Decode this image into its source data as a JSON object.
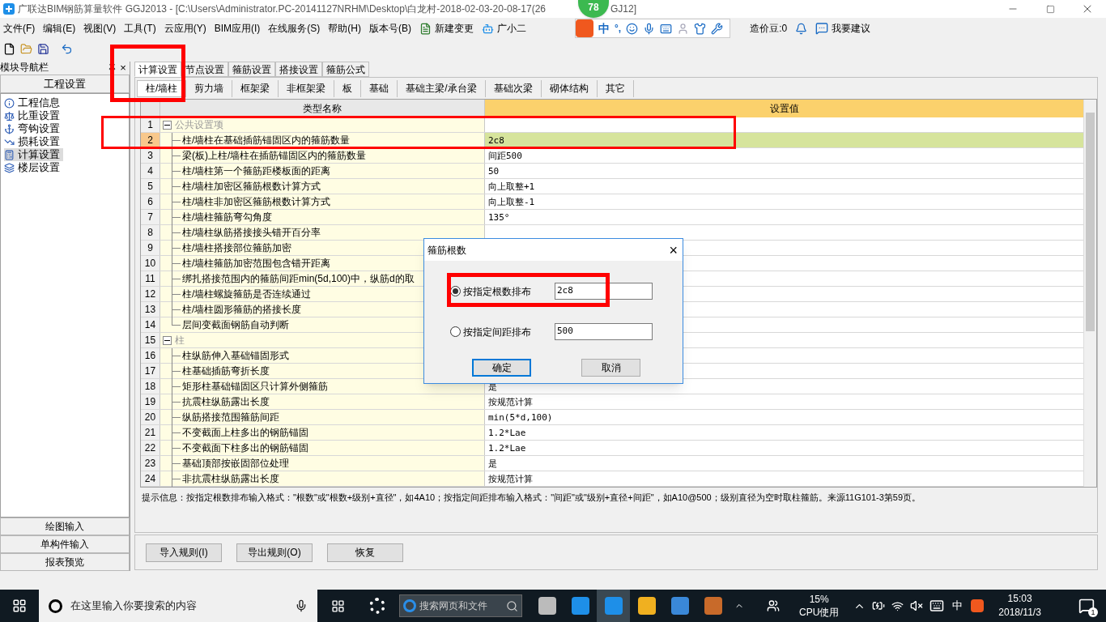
{
  "window": {
    "title": "广联达BIM钢筋算量软件 GGJ2013 - [C:\\Users\\Administrator.PC-20141127NRHM\\Desktop\\白龙村-2018-02-03-20-08-17(26",
    "title_tail": "GJ12]",
    "badge": "78"
  },
  "menu": [
    "文件(F)",
    "编辑(E)",
    "视图(V)",
    "工具(T)",
    "云应用(Y)",
    "BIM应用(I)",
    "在线服务(S)",
    "帮助(H)",
    "版本号(B)",
    "新建变更",
    "广小二"
  ],
  "ime": {
    "mode": "中",
    "punct": "°,"
  },
  "account": {
    "beans": "造价豆:0",
    "feedback": "我要建议"
  },
  "nav": {
    "title": "模块导航栏",
    "close": "×",
    "section": "工程设置",
    "items": [
      {
        "label": "工程信息",
        "selected": false
      },
      {
        "label": "比重设置",
        "selected": false
      },
      {
        "label": "弯钩设置",
        "selected": false
      },
      {
        "label": "损耗设置",
        "selected": false
      },
      {
        "label": "计算设置",
        "selected": true
      },
      {
        "label": "楼层设置",
        "selected": false
      }
    ],
    "bottom": [
      "绘图输入",
      "单构件输入",
      "报表预览"
    ]
  },
  "tabs": [
    {
      "label": "计算设置",
      "selected": true
    },
    {
      "label": "节点设置",
      "selected": false
    },
    {
      "label": "箍筋设置",
      "selected": false
    },
    {
      "label": "搭接设置",
      "selected": false
    },
    {
      "label": "箍筋公式",
      "selected": false
    }
  ],
  "subtabs": [
    {
      "label": "柱/墙柱",
      "selected": true
    },
    {
      "label": "剪力墙",
      "selected": false
    },
    {
      "label": "框架梁",
      "selected": false
    },
    {
      "label": "非框架梁",
      "selected": false
    },
    {
      "label": "板",
      "selected": false
    },
    {
      "label": "基础",
      "selected": false
    },
    {
      "label": "基础主梁/承台梁",
      "selected": false
    },
    {
      "label": "基础次梁",
      "selected": false
    },
    {
      "label": "砌体结构",
      "selected": false
    },
    {
      "label": "其它",
      "selected": false
    }
  ],
  "table": {
    "columns": [
      "类型名称",
      "设置值"
    ],
    "groups": [
      {
        "number": "1",
        "name": "公共设置项",
        "expanded": true,
        "children": [
          {
            "number": "2",
            "name": "柱/墙柱在基础插筋锚固区内的箍筋数量",
            "value": "2c8",
            "selected": true
          },
          {
            "number": "3",
            "name": "梁(板)上柱/墙柱在插筋锚固区内的箍筋数量",
            "value": "间距500",
            "selected": false
          },
          {
            "number": "4",
            "name": "柱/墙柱第一个箍筋距楼板面的距离",
            "value": "50",
            "selected": false
          },
          {
            "number": "5",
            "name": "柱/墙柱加密区箍筋根数计算方式",
            "value": "向上取整+1",
            "selected": false
          },
          {
            "number": "6",
            "name": "柱/墙柱非加密区箍筋根数计算方式",
            "value": "向上取整-1",
            "selected": false
          },
          {
            "number": "7",
            "name": "柱/墙柱箍筋弯勾角度",
            "value": "135°",
            "selected": false
          },
          {
            "number": "8",
            "name": "柱/墙柱纵筋搭接接头错开百分率",
            "selected": false
          },
          {
            "number": "9",
            "name": "柱/墙柱搭接部位箍筋加密",
            "selected": false
          },
          {
            "number": "10",
            "name": "柱/墙柱箍筋加密范围包含错开距离",
            "selected": false
          },
          {
            "number": "11",
            "name": "绑扎搭接范围内的箍筋间距min(5d,100)中，纵筋d的取",
            "selected": false
          },
          {
            "number": "12",
            "name": "柱/墙柱螺旋箍筋是否连续通过",
            "selected": false
          },
          {
            "number": "13",
            "name": "柱/墙柱圆形箍筋的搭接长度",
            "selected": false
          },
          {
            "number": "14",
            "name": "层间变截面钢筋自动判断",
            "selected": false
          }
        ]
      },
      {
        "number": "15",
        "name": "柱",
        "expanded": true,
        "children": [
          {
            "number": "16",
            "name": "柱纵筋伸入基础锚固形式",
            "selected": false
          },
          {
            "number": "17",
            "name": "柱基础插筋弯折长度",
            "selected": false
          },
          {
            "number": "18",
            "name": "矩形柱基础锚固区只计算外侧箍筋",
            "value": "是",
            "selected": false
          },
          {
            "number": "19",
            "name": "抗震柱纵筋露出长度",
            "value": "按规范计算",
            "selected": false
          },
          {
            "number": "20",
            "name": "纵筋搭接范围箍筋间距",
            "value": "min(5*d,100)",
            "selected": false
          },
          {
            "number": "21",
            "name": "不变截面上柱多出的钢筋锚固",
            "value": "1.2*Lae",
            "selected": false
          },
          {
            "number": "22",
            "name": "不变截面下柱多出的钢筋锚固",
            "value": "1.2*Lae",
            "selected": false
          },
          {
            "number": "23",
            "name": "基础顶部按嵌固部位处理",
            "value": "是",
            "selected": false
          },
          {
            "number": "24",
            "name": "非抗震柱纵筋露出长度",
            "value": "按规范计算",
            "selected": false
          }
        ]
      }
    ]
  },
  "hint": "提示信息：按指定根数排布输入格式：\"根数\"或\"根数+级别+直径\"，如4A10；按指定间距排布输入格式：\"间距\"或\"级别+直径+间距\"，如A10@500；级别直径为空时取柱箍筋。来源11G101-3第59页。",
  "actions": [
    "导入规则(I)",
    "导出规则(O)",
    "恢复"
  ],
  "dialog": {
    "title": "箍筋根数",
    "close": "×",
    "options": [
      {
        "label": "按指定根数排布",
        "value": "2c8",
        "selected": true
      },
      {
        "label": "按指定间距排布",
        "value": "500",
        "selected": false
      }
    ],
    "buttons": [
      "确定",
      "取消"
    ]
  },
  "taskbar": {
    "search_placeholder": "在这里输入你要搜索的内容",
    "browser_search": "搜索网页和文件",
    "cpu": "15%",
    "cpu_label": "CPU使用",
    "ime": "中",
    "time": "15:03",
    "date": "2018/11/3",
    "notifications": "1"
  }
}
